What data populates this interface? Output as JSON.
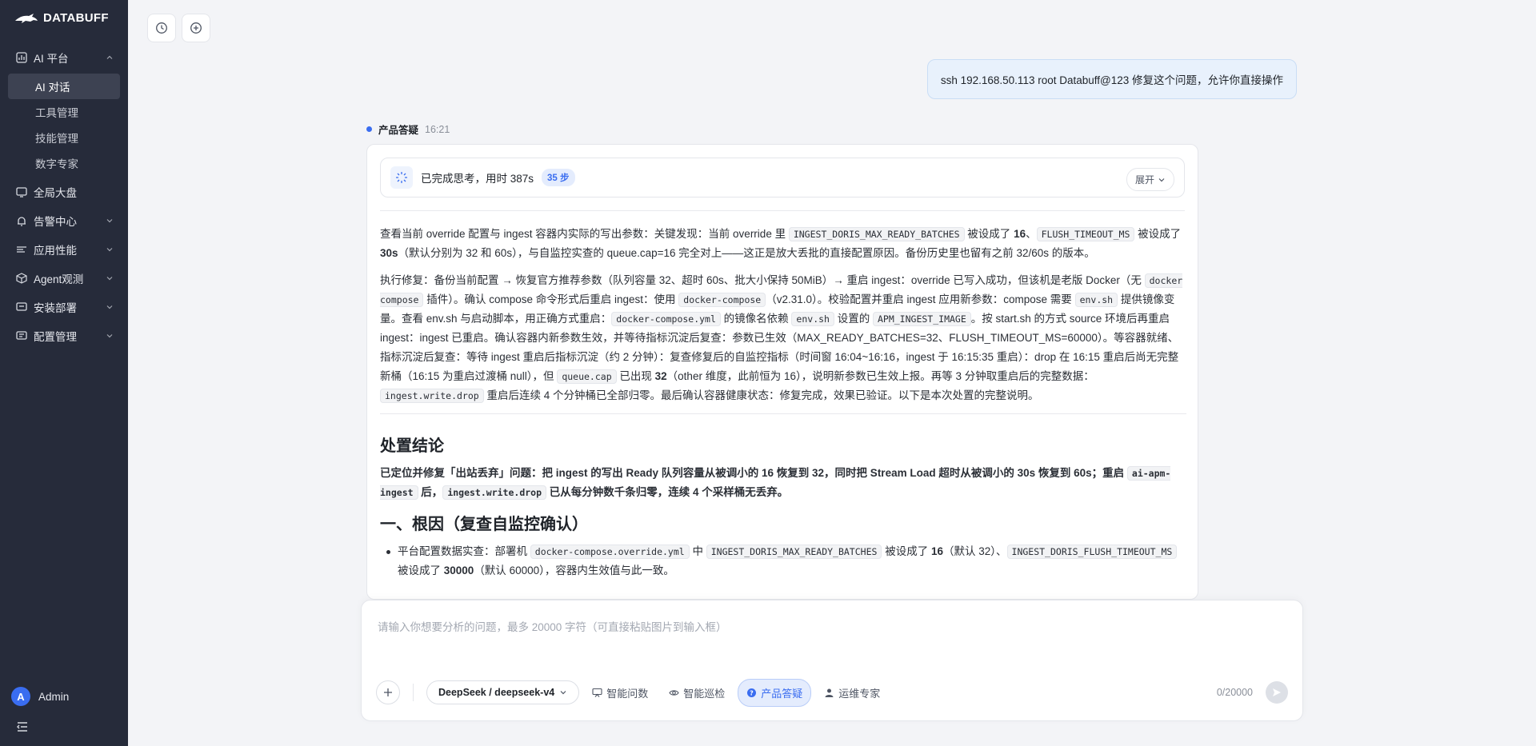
{
  "brand": "DATABUFF",
  "sidebar": {
    "items": [
      {
        "label": "AI 平台",
        "icon": "chart-icon",
        "expanded": true,
        "children": [
          "AI 对话",
          "工具管理",
          "技能管理",
          "数字专家"
        ],
        "active_child": "AI 对话"
      },
      {
        "label": "全局大盘",
        "icon": "dashboard-icon"
      },
      {
        "label": "告警中心",
        "icon": "alert-icon"
      },
      {
        "label": "应用性能",
        "icon": "performance-icon"
      },
      {
        "label": "Agent观测",
        "icon": "cube-icon"
      },
      {
        "label": "安装部署",
        "icon": "install-icon"
      },
      {
        "label": "配置管理",
        "icon": "settings-icon"
      }
    ],
    "user": {
      "initial": "A",
      "name": "Admin"
    }
  },
  "chat": {
    "user_message": "ssh 192.168.50.113 root Databuff@123 修复这个问题，允许你直接操作",
    "assistant_name": "产品答疑",
    "assistant_time": "16:21",
    "thinking": {
      "text": "已完成思考，用时 387s",
      "steps": "35 步",
      "expand_label": "展开"
    },
    "heading_conclusion": "处置结论",
    "heading_root": "一、根因（复查自监控确认）"
  },
  "composer": {
    "placeholder": "请输入你想要分析的问题，最多 20000 字符（可直接粘贴图片到输入框）",
    "model": "DeepSeek / deepseek-v4",
    "modes": [
      "智能问数",
      "智能巡检",
      "产品答疑",
      "运维专家"
    ],
    "active_mode": "产品答疑",
    "counter": "0/20000"
  },
  "colors": {
    "accent": "#3a6df0",
    "sidebar_bg": "#262b3a"
  }
}
